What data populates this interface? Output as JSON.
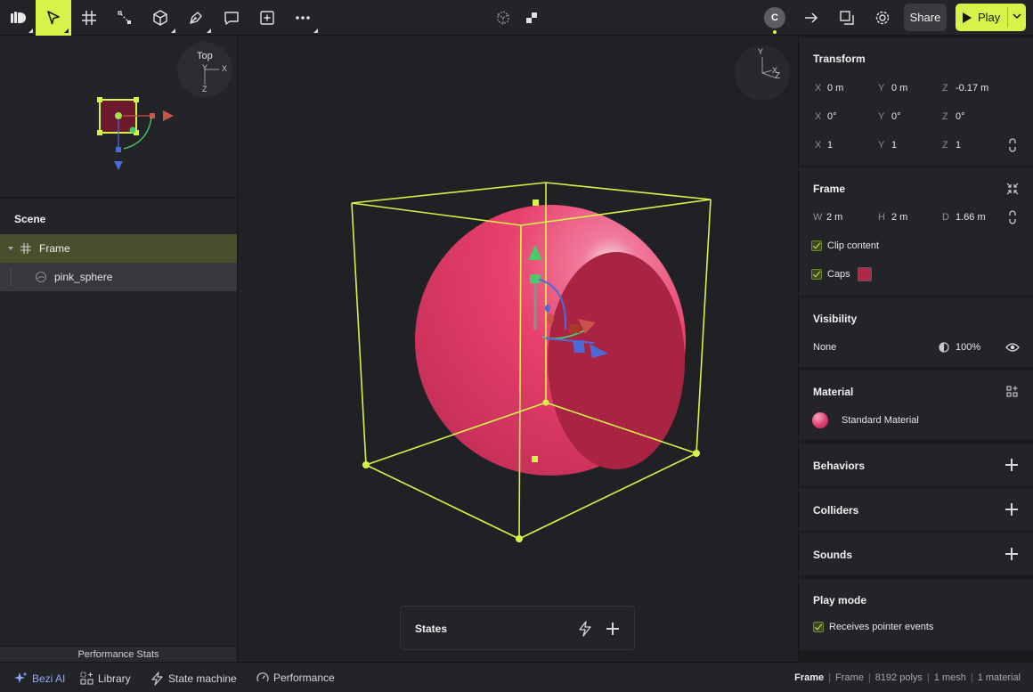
{
  "toolbar": {
    "tools": [
      {
        "icon": "bezi-logo-icon"
      },
      {
        "icon": "select-cursor-icon",
        "active": true
      },
      {
        "icon": "frame-grid-icon"
      },
      {
        "icon": "transform-resize-icon"
      },
      {
        "icon": "cube-icon"
      },
      {
        "icon": "pen-icon"
      },
      {
        "icon": "comment-icon"
      },
      {
        "icon": "add-box-icon"
      },
      {
        "icon": "more-icon"
      }
    ],
    "avatar_initial": "C",
    "share_label": "Share",
    "play_label": "Play",
    "accent_color": "#d7f34a"
  },
  "minimap": {
    "view_label": "Top",
    "axis_x": "X",
    "axis_y": "Y",
    "axis_z": "Z"
  },
  "viewport_gizmo": {
    "axis_x": "X",
    "axis_y": "Y",
    "axis_z": "Z"
  },
  "scene": {
    "title": "Scene",
    "items": [
      {
        "label": "Frame"
      },
      {
        "label": "pink_sphere"
      }
    ],
    "perf_stats_label": "Performance Stats"
  },
  "states": {
    "label": "States"
  },
  "transform": {
    "title": "Transform",
    "position": {
      "x_label": "X",
      "x": "0 m",
      "y_label": "Y",
      "y": "0 m",
      "z_label": "Z",
      "z": "-0.17 m"
    },
    "rotation": {
      "x_label": "X",
      "x": "0°",
      "y_label": "Y",
      "y": "0°",
      "z_label": "Z",
      "z": "0°"
    },
    "scale": {
      "x_label": "X",
      "x": "1",
      "y_label": "Y",
      "y": "1",
      "z_label": "Z",
      "z": "1"
    }
  },
  "frame": {
    "title": "Frame",
    "w_label": "W",
    "w": "2 m",
    "h_label": "H",
    "h": "2 m",
    "d_label": "D",
    "d": "1.66 m",
    "clip_label": "Clip content",
    "caps_label": "Caps",
    "caps_color": "#b3264a"
  },
  "visibility": {
    "title": "Visibility",
    "mode": "None",
    "opacity": "100%"
  },
  "material": {
    "title": "Material",
    "name": "Standard Material",
    "swatch_color": "#e23e6e"
  },
  "behaviors": {
    "title": "Behaviors"
  },
  "colliders": {
    "title": "Colliders"
  },
  "sounds": {
    "title": "Sounds"
  },
  "play_mode": {
    "title": "Play mode",
    "pointer_label": "Receives pointer events"
  },
  "bottombar": {
    "ai_label": "Bezi AI",
    "library_label": "Library",
    "state_machine_label": "State machine",
    "performance_label": "Performance",
    "status": {
      "selection": "Frame",
      "type": "Frame",
      "polys": "8192 polys",
      "meshes": "1 mesh",
      "materials": "1 material"
    }
  }
}
